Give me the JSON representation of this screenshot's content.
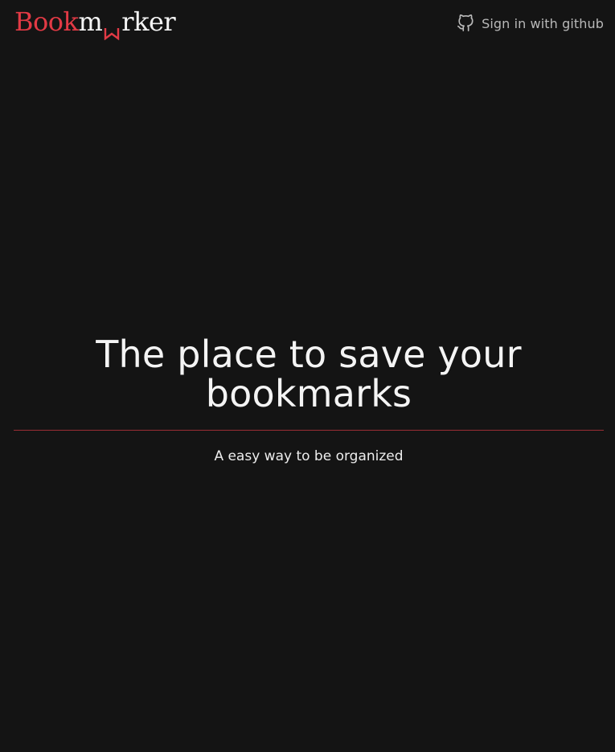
{
  "header": {
    "logo": {
      "part1": "Book",
      "part2": "m",
      "part3": "rker",
      "accent_color": "#e23a45",
      "icon": "bookmark-icon"
    },
    "signin": {
      "label": "Sign in with github",
      "icon": "github-icon"
    }
  },
  "hero": {
    "title": "The place to save your bookmarks",
    "subtitle": "A easy way to be organized",
    "divider_color": "#9a2d35"
  },
  "theme": {
    "background": "#141414",
    "text": "#f4f4f4",
    "muted": "#b9b9b9"
  }
}
